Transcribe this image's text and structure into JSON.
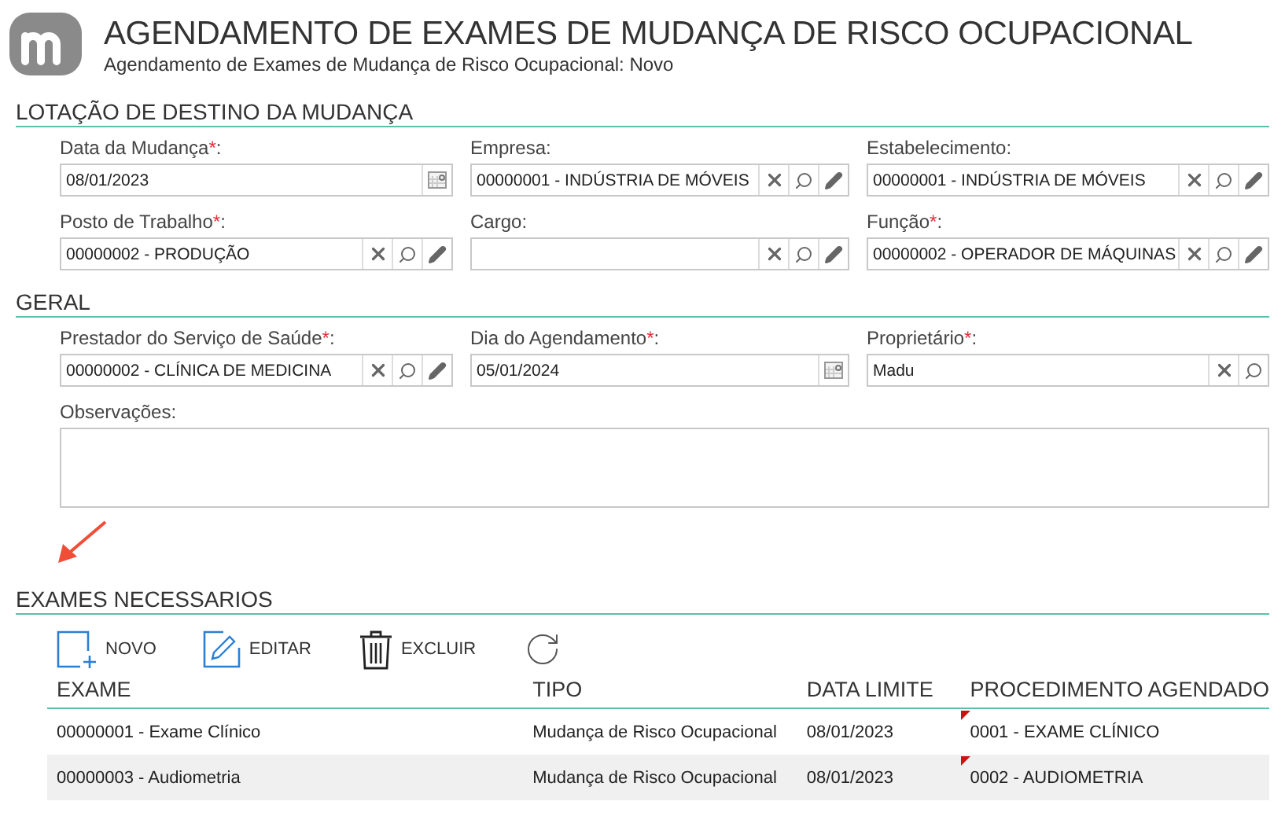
{
  "header": {
    "title": "AGENDAMENTO DE EXAMES DE MUDANÇA DE RISCO OCUPACIONAL",
    "subtitle": "Agendamento de Exames de Mudança de Risco Ocupacional: Novo"
  },
  "sections": [
    {
      "title": "LOTAÇÃO DE DESTINO DA MUDANÇA",
      "fields": [
        {
          "kind": "date",
          "label": "Data da Mudança",
          "required_mark": "*",
          "label_end": ":",
          "value": "08/01/2023"
        },
        {
          "kind": "lookup",
          "label": "Empresa",
          "label_end": ":",
          "value": "00000001 - INDÚSTRIA DE MÓVEIS",
          "editable": true
        },
        {
          "kind": "lookup",
          "label": "Estabelecimento",
          "label_end": ":",
          "value": "00000001 - INDÚSTRIA DE MÓVEIS",
          "editable": true
        },
        {
          "kind": "lookup",
          "label": "Posto de Trabalho",
          "required_mark": "*",
          "label_end": ":",
          "value": "00000002 - PRODUÇÃO",
          "editable": true
        },
        {
          "kind": "lookup",
          "label": "Cargo",
          "label_end": ":",
          "editable": true
        },
        {
          "kind": "lookup",
          "label": "Função",
          "required_mark": "*",
          "label_end": ":",
          "value": "00000002 - OPERADOR DE MÁQUINAS",
          "editable": true
        }
      ]
    },
    {
      "title": "GERAL",
      "fields": [
        {
          "kind": "lookup",
          "label": "Prestador do Serviço de Saúde",
          "required_mark": "*",
          "label_end": ":",
          "value": "00000002 - CLÍNICA DE MEDICINA",
          "editable": true
        },
        {
          "kind": "date",
          "label": "Dia do Agendamento",
          "required_mark": "*",
          "label_end": ":",
          "value": "05/01/2024"
        },
        {
          "kind": "lookup",
          "label": "Proprietário",
          "required_mark": "*",
          "label_end": ":",
          "value": "Madu",
          "editable": false
        },
        {
          "kind": "textarea",
          "label": "Observações",
          "label_end": ":"
        }
      ]
    }
  ],
  "exams": {
    "title": "EXAMES NECESSARIOS",
    "toolbar": [
      {
        "kind": "new",
        "label": "NOVO"
      },
      {
        "kind": "edit",
        "label": "EDITAR"
      },
      {
        "kind": "delete",
        "label": "EXCLUIR"
      },
      {
        "kind": "refresh"
      }
    ],
    "columns": [
      "EXAME",
      "TIPO",
      "DATA LIMITE",
      "PROCEDIMENTO AGENDADO"
    ],
    "rows": [
      {
        "cells": [
          "00000001 - Exame Clínico",
          "Mudança de Risco Ocupacional",
          "08/01/2023",
          "0001 - EXAME CLÍNICO"
        ],
        "flagged": true
      },
      {
        "cells": [
          "00000003 - Audiometria",
          "Mudança de Risco Ocupacional",
          "08/01/2023",
          "0002 - AUDIOMETRIA"
        ],
        "flagged": true
      }
    ]
  }
}
